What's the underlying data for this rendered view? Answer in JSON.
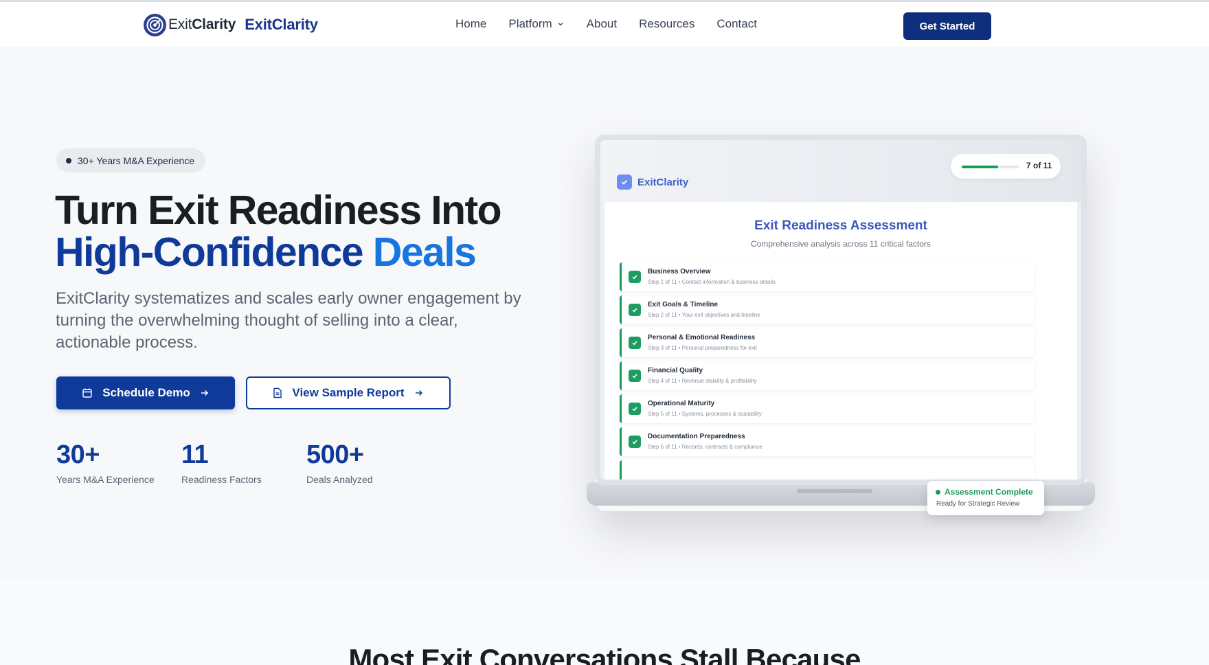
{
  "header": {
    "logo_prefix": "Exit",
    "logo_suffix": "Clarity",
    "brand_name": "ExitClarity",
    "nav": [
      {
        "label": "Home",
        "has_dropdown": false
      },
      {
        "label": "Platform",
        "has_dropdown": true
      },
      {
        "label": "About",
        "has_dropdown": false
      },
      {
        "label": "Resources",
        "has_dropdown": false
      },
      {
        "label": "Contact",
        "has_dropdown": false
      }
    ],
    "cta_label": "Get Started"
  },
  "hero": {
    "badge": "30+ Years M&A Experience",
    "headline_line1": "Turn Exit Readiness Into",
    "headline_line2a": "High-Confidence",
    "headline_line2b": "Deals",
    "lede": "ExitClarity systematizes and scales early owner engagement by turning the overwhelming thought of selling into a clear, actionable process.",
    "primary_button": "Schedule Demo",
    "secondary_button": "View Sample Report",
    "stats": [
      {
        "value": "30+",
        "label": "Years M&A Experience"
      },
      {
        "value": "11",
        "label": "Readiness Factors"
      },
      {
        "value": "500+",
        "label": "Deals Analyzed"
      }
    ]
  },
  "mockup": {
    "app_name": "ExitClarity",
    "progress_label": "7 of 11",
    "progress_fraction": 0.636,
    "title": "Exit Readiness Assessment",
    "subtitle": "Comprehensive analysis across 11 critical factors",
    "steps": [
      {
        "title": "Business Overview",
        "sub": "Step 1 of 11 • Contact information & business details"
      },
      {
        "title": "Exit Goals & Timeline",
        "sub": "Step 2 of 11 • Your exit objectives and timeline"
      },
      {
        "title": "Personal & Emotional Readiness",
        "sub": "Step 3 of 11 • Personal preparedness for exit"
      },
      {
        "title": "Financial Quality",
        "sub": "Step 4 of 11 • Revenue stability & profitability"
      },
      {
        "title": "Operational Maturity",
        "sub": "Step 5 of 11 • Systems, processes & scalability"
      },
      {
        "title": "Documentation Preparedness",
        "sub": "Step 6 of 11 • Records, contracts & compliance"
      }
    ],
    "toast_title": "Assessment Complete",
    "toast_sub": "Ready for Strategic Review",
    "accent_green": "#1a9a5c",
    "accent_blue": "#103a99"
  },
  "section2": {
    "heading": "Most Exit Conversations Stall Because"
  }
}
